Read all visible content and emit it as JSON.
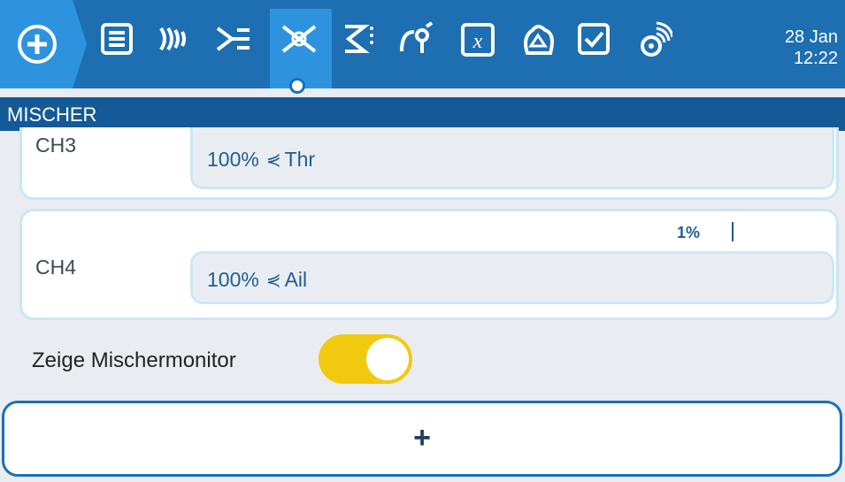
{
  "header": {
    "title": "MISCHER",
    "date": "28 Jan",
    "time": "12:22",
    "tabs": [
      {
        "icon": "home-plus-icon"
      },
      {
        "icon": "list-icon"
      },
      {
        "icon": "radio-waves-icon"
      },
      {
        "icon": "mixer-icon"
      },
      {
        "icon": "outputs-icon",
        "active": true
      },
      {
        "icon": "curves-icon"
      },
      {
        "icon": "logic-switch-icon"
      },
      {
        "icon": "special-function-icon"
      },
      {
        "icon": "timer-icon"
      },
      {
        "icon": "checklist-icon"
      },
      {
        "icon": "telemetry-icon"
      }
    ]
  },
  "channels": [
    {
      "label": "CH3",
      "value": "100%",
      "source": "Thr"
    },
    {
      "label": "CH4",
      "value": "100%",
      "source": "Ail",
      "monitor": "1%"
    }
  ],
  "toggle": {
    "label": "Zeige Mischermonitor",
    "state": true
  },
  "add_button": {
    "label": "+"
  },
  "colors": {
    "header": "#1e6fb2",
    "active_tab": "#2d93df",
    "toggle_on": "#f1c90f"
  }
}
